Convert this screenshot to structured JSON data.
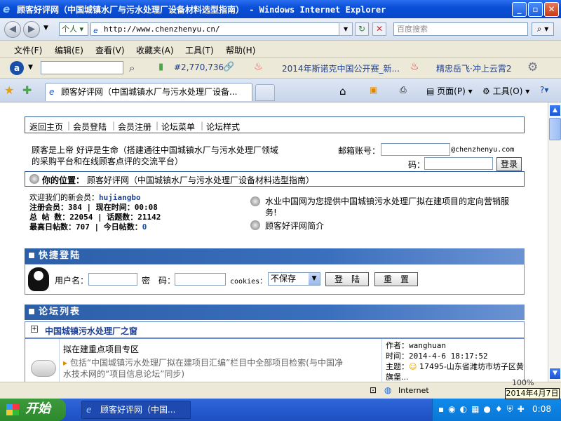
{
  "window": {
    "title": "顾客好评网（中国城镇水厂与污水处理厂设备材料选型指南） - Windows Internet Explorer"
  },
  "address_bar": {
    "personal_label": "个人",
    "url": "http://www.chenzhenyu.cn/",
    "search_placeholder": "百度搜索"
  },
  "menu": [
    "文件(F)",
    "编辑(E)",
    "查看(V)",
    "收藏夹(A)",
    "工具(T)",
    "帮助(H)"
  ],
  "toolbar": {
    "rank": "#2,770,736",
    "link1": "2014年斯诺克中国公开赛_新...",
    "link2": "精忠岳飞·冲上云霄2"
  },
  "tab": {
    "title": "顾客好评网（中国城镇水厂与污水处理厂设备...",
    "page_label": "页面(P)",
    "tools_label": "工具(O)"
  },
  "page": {
    "topnav": [
      "返回主页",
      "会员登陆",
      "会员注册",
      "论坛菜单",
      "论坛样式"
    ],
    "slogan": "顾客是上帝 好评是生命（搭建通往中国城镇水厂与污水处理厂领域的采购平台和在线顾客点评的交流平台）",
    "email_label": "邮箱账号：",
    "email_suffix": "@chenzhenyu.com",
    "password_label": "码：",
    "login_btn": "登录",
    "location_label": "你的位置：",
    "location_value": "顾客好评网（中国城镇水厂与污水处理厂设备材料选型指南）",
    "stats": {
      "welcome_label": "欢迎我们的新会员：",
      "new_member": "hujiangbo",
      "line2": "注册会员：384 | 现在时间：00:08",
      "line3": "总 帖 数：22054 | 话题数：21142",
      "line4a": "最高日帖数：707 | 今日帖数：",
      "today_posts": "0"
    },
    "notice1": "水业中国网为您提供中国城镇污水处理厂拟在建项目的定向营销服务!",
    "notice2": "顾客好评网简介",
    "quick_login": {
      "header": "快捷登陆",
      "username_label": "用户名：",
      "password_label": "密　码：",
      "cookies_label": "cookies：",
      "cookies_value": "不保存",
      "login_btn": "登　陆",
      "reset_btn": "重　置"
    },
    "forum_list": {
      "header": "论坛列表",
      "category": "中国城镇污水处理厂之窗",
      "board_title": "拟在建重点项目专区",
      "board_desc": "包括“中国城镇污水处理厂拟在建项目汇编”栏目中全部项目检索(与中国净水技术网的“项目信息论坛”同步)",
      "author_label": "作者：",
      "author": "wanghuan",
      "time_label": "时间：",
      "time": "2014-4-6 18:17:52",
      "topic_label": "主题：",
      "topic": "17495-山东省潍坊市坊子区黄旗堡..."
    }
  },
  "status_bar": {
    "zone": "Internet",
    "zoom": "100%"
  },
  "taskbar": {
    "start": "开始",
    "item": "顾客好评网（中国...",
    "time": "0:08",
    "date_tip": "2014年4月7日"
  },
  "colors": {
    "title_bar": "#0a4fd8",
    "section_header": "#2c5fa8",
    "link_blue": "#1f3f8f",
    "taskbar": "#245ad0",
    "start_green": "#2c8a2c"
  }
}
